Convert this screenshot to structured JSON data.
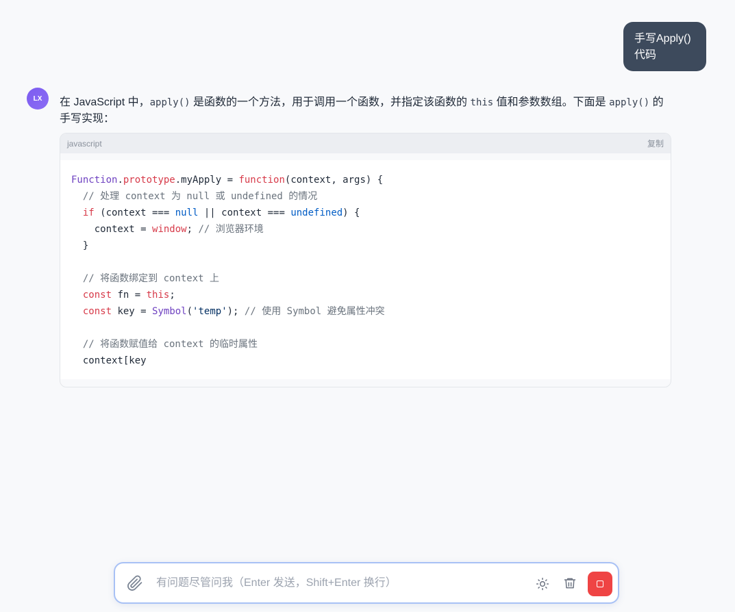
{
  "user_message": {
    "line1": "手写Apply()",
    "line2": "代码"
  },
  "assistant": {
    "avatar_initials": "LX",
    "intro": {
      "p1": "在 JavaScript 中，",
      "c1": "apply()",
      "p2": " 是函数的一个方法，用于调用一个函数，并指定该函数的 ",
      "c2": "this",
      "p3": " 值和参数数组。下面是 ",
      "c3": "apply()",
      "p4": " 的手写实现："
    },
    "code_block": {
      "language": "javascript",
      "copy_label": "复制",
      "lines": [
        [
          [
            "fn",
            "Function"
          ],
          [
            "",
            "."
          ],
          [
            "kw",
            "prototype"
          ],
          [
            "",
            ".myApply = "
          ],
          [
            "kw",
            "function"
          ],
          [
            "",
            "(context, args) {"
          ]
        ],
        [
          [
            "cm",
            "  // 处理 context 为 null 或 undefined 的情况"
          ]
        ],
        [
          [
            "",
            "  "
          ],
          [
            "kw",
            "if"
          ],
          [
            "",
            " (context === "
          ],
          [
            "lit",
            "null"
          ],
          [
            "",
            " || context === "
          ],
          [
            "lit",
            "undefined"
          ],
          [
            "",
            ") {"
          ]
        ],
        [
          [
            "",
            "    context = "
          ],
          [
            "kw",
            "window"
          ],
          [
            "",
            "; "
          ],
          [
            "cm",
            "// 浏览器环境"
          ]
        ],
        [
          [
            "",
            "  }"
          ]
        ],
        [
          [
            "",
            ""
          ]
        ],
        [
          [
            "cm",
            "  // 将函数绑定到 context 上"
          ]
        ],
        [
          [
            "",
            "  "
          ],
          [
            "kw",
            "const"
          ],
          [
            "",
            " fn = "
          ],
          [
            "kw",
            "this"
          ],
          [
            "",
            ";"
          ]
        ],
        [
          [
            "",
            "  "
          ],
          [
            "kw",
            "const"
          ],
          [
            "",
            " key = "
          ],
          [
            "fn",
            "Symbol"
          ],
          [
            "",
            "("
          ],
          [
            "str",
            "'temp'"
          ],
          [
            "",
            "); "
          ],
          [
            "cm",
            "// 使用 Symbol 避免属性冲突"
          ]
        ],
        [
          [
            "",
            ""
          ]
        ],
        [
          [
            "cm",
            "  // 将函数赋值给 context 的临时属性"
          ]
        ],
        [
          [
            "",
            "  context[key"
          ]
        ]
      ]
    }
  },
  "composer": {
    "placeholder": "有问题尽管问我（Enter 发送，Shift+Enter 换行）",
    "value": ""
  },
  "colors": {
    "accent_stop": "#ef4444",
    "user_bubble": "#3d4a5c",
    "avatar": "#7c5cf0"
  }
}
